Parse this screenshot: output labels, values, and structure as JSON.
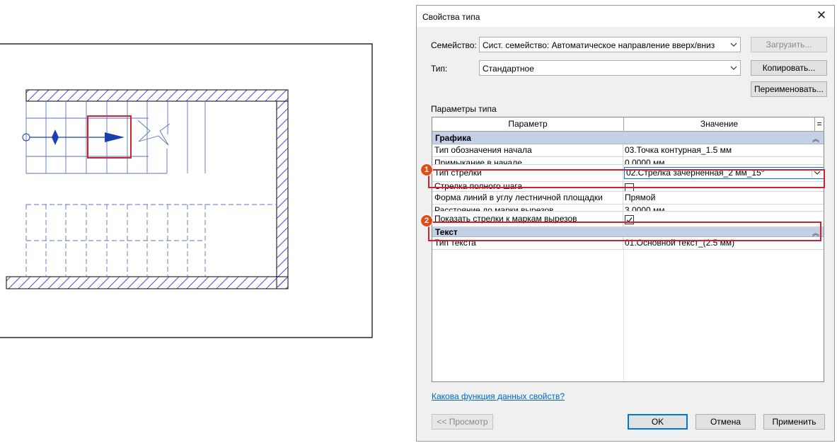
{
  "dialog": {
    "title": "Свойства типа",
    "close_icon": "close-icon",
    "family_label": "Семейство:",
    "family_value": "Сист. семейство: Автоматическое направление вверх/вниз",
    "load_button": "Загрузить...",
    "type_label": "Тип:",
    "type_value": "Стандартное",
    "copy_button": "Копировать...",
    "rename_button": "Переименовать...",
    "params_label": "Параметры типа",
    "columns": {
      "param": "Параметр",
      "value": "Значение",
      "menu": "="
    },
    "groups": [
      {
        "name": "Графика",
        "rows": [
          {
            "param": "Тип обозначения начала",
            "value": "03.Точка контурная_1.5 мм"
          },
          {
            "param": "Примыкание в начале",
            "value": "0.0000 мм"
          },
          {
            "param": "Тип стрелки",
            "value": "02.Стрелка зачерненная_2 мм_15°"
          },
          {
            "param": "Стрелка полного шага",
            "value": ""
          },
          {
            "param": "Форма линий в углу лестничной площадки",
            "value": "Прямой"
          },
          {
            "param": "Расстояние до марки вырезов",
            "value": "3.0000 мм"
          },
          {
            "param": "Показать стрелки к маркам вырезов",
            "value": ""
          }
        ]
      },
      {
        "name": "Текст",
        "rows": [
          {
            "param": "Тип текста",
            "value": "01.Основной текст_(2.5 мм)"
          }
        ]
      }
    ],
    "help_link": "Какова функция данных свойств?",
    "preview_button": "<< Просмотр",
    "ok_button": "OK",
    "cancel_button": "Отмена",
    "apply_button": "Применить",
    "badges": [
      "1",
      "2"
    ],
    "checkboxes": {
      "full_step_arrow": false,
      "show_cut_arrows": true
    }
  },
  "colors": {
    "highlight": "#d0212f",
    "badge": "#e04b17",
    "group_bg": "#c3d0e6",
    "arrow": "#1a3fb0",
    "link": "#0066cc"
  }
}
